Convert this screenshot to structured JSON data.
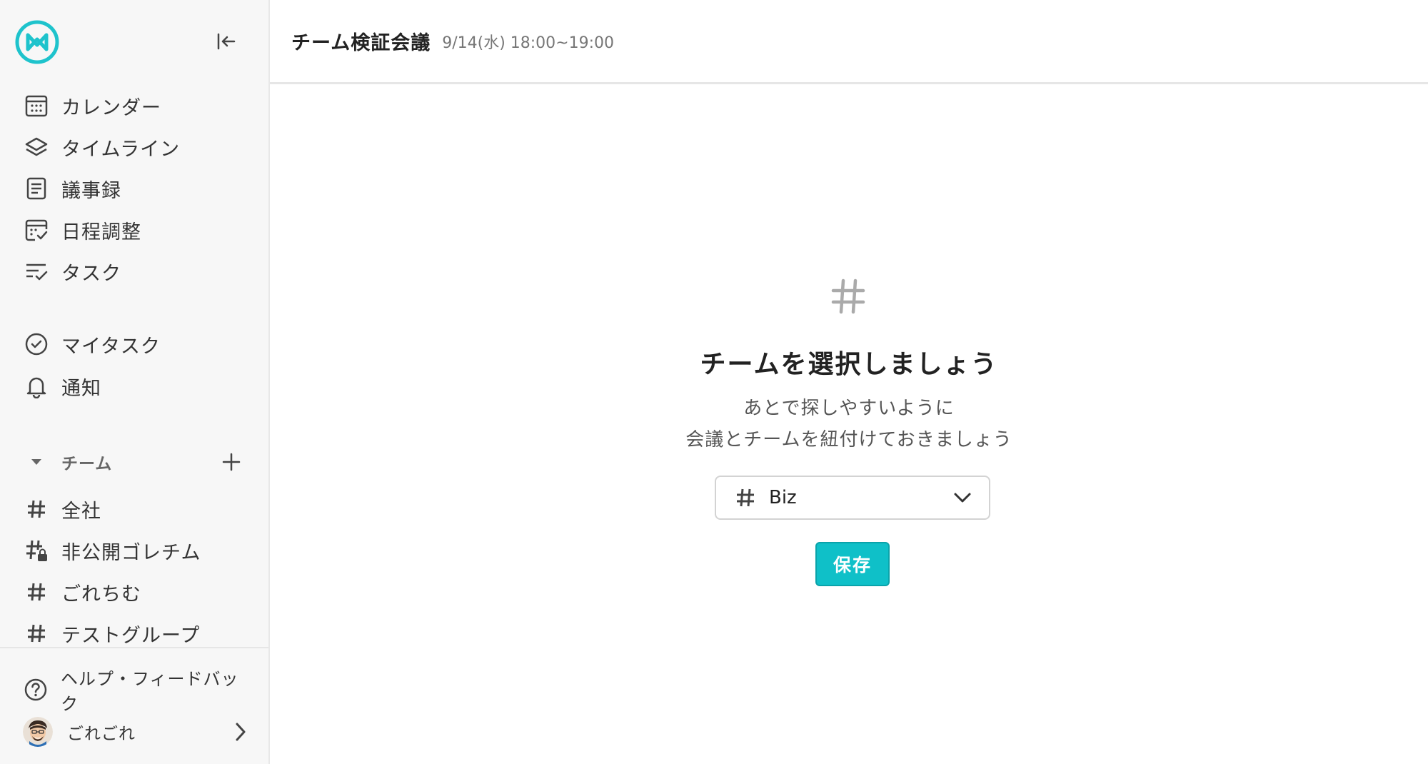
{
  "sidebar": {
    "nav": [
      {
        "label": "カレンダー",
        "icon": "calendar-icon"
      },
      {
        "label": "タイムライン",
        "icon": "layers-icon"
      },
      {
        "label": "議事録",
        "icon": "document-icon"
      },
      {
        "label": "日程調整",
        "icon": "calendar-check-icon"
      },
      {
        "label": "タスク",
        "icon": "task-list-icon"
      }
    ],
    "personal": [
      {
        "label": "マイタスク",
        "icon": "check-circle-icon"
      },
      {
        "label": "通知",
        "icon": "bell-icon"
      }
    ],
    "team_section_label": "チーム",
    "teams": [
      {
        "label": "全社",
        "icon": "hash-icon"
      },
      {
        "label": "非公開ゴレチム",
        "icon": "hash-lock-icon"
      },
      {
        "label": "ごれちむ",
        "icon": "hash-icon"
      },
      {
        "label": "テストグループ",
        "icon": "hash-icon"
      }
    ],
    "help_label": "ヘルプ・フィードバック",
    "user_name": "ごれごれ"
  },
  "header": {
    "title": "チーム検証会議",
    "datetime": "9/14(水) 18:00~19:00"
  },
  "main": {
    "empty_title": "チームを選択しましょう",
    "desc_line1": "あとで探しやすいように",
    "desc_line2": "会議とチームを紐付けておきましょう",
    "team_select_value": "Biz",
    "save_label": "保存"
  },
  "colors": {
    "accent": "#0fc0c8",
    "logo": "#1ec3cc"
  }
}
